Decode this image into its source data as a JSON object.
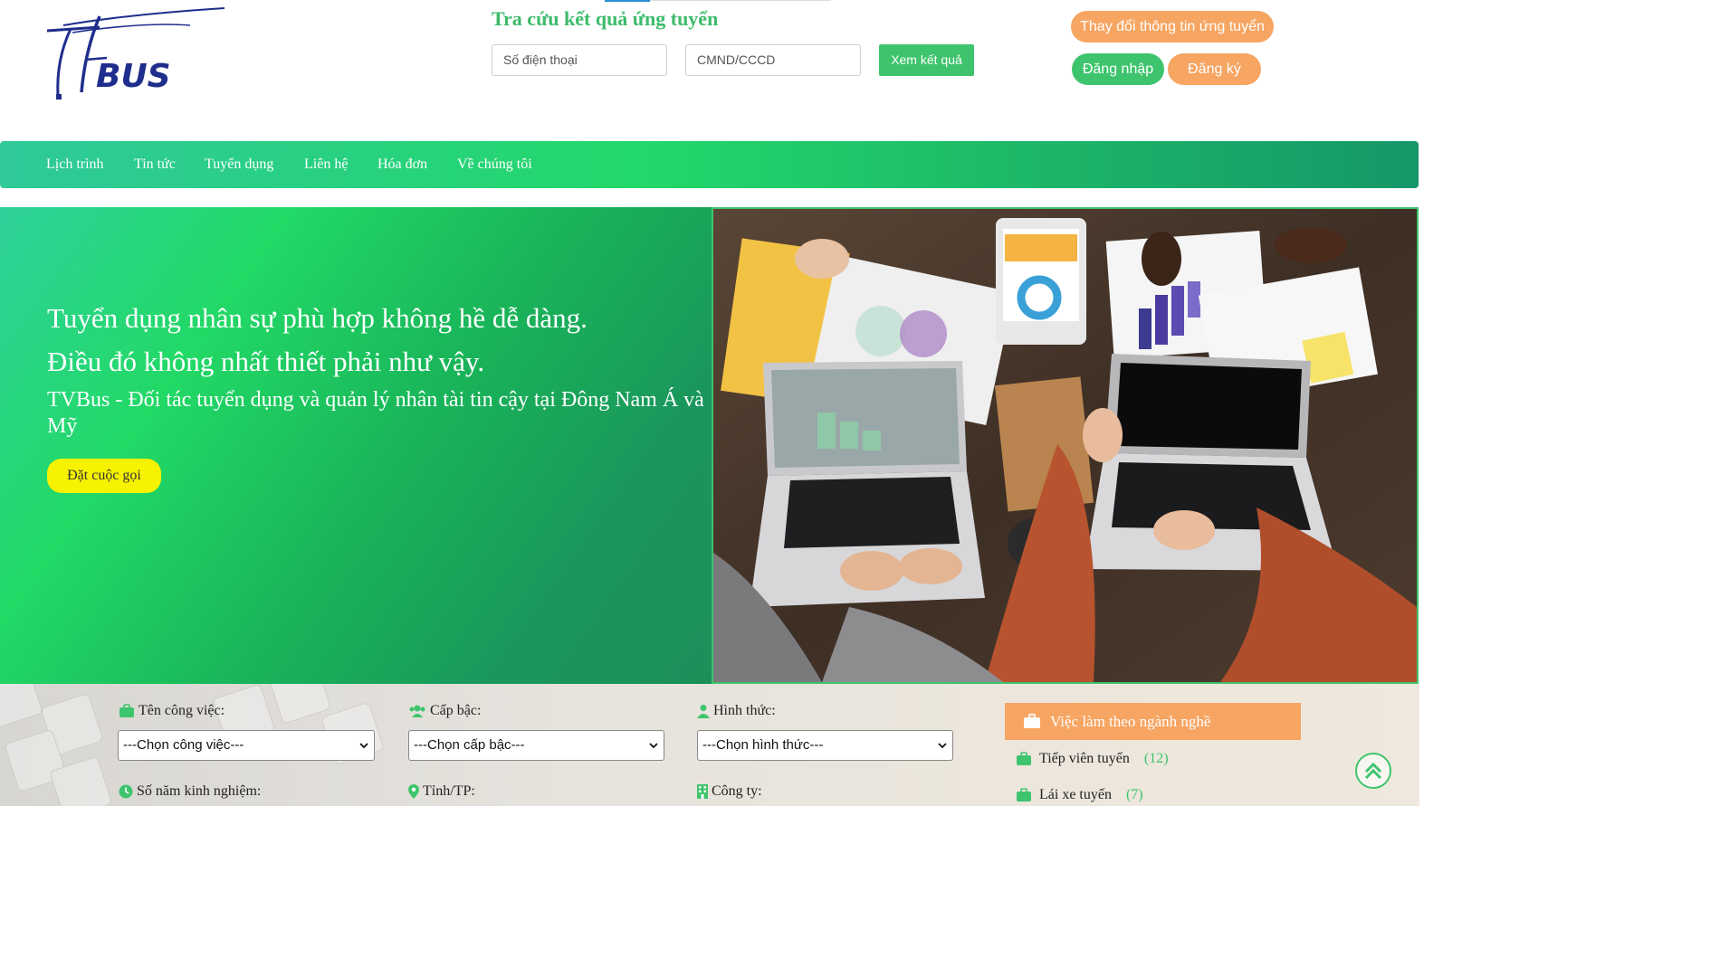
{
  "header": {
    "logo_text": "BUS",
    "lookup_title": "Tra cứu kết quả ứng tuyển",
    "phone_placeholder": "Số điện thoại",
    "id_placeholder": "CMND/CCCD",
    "result_button": "Xem kết quả",
    "change_info_button": "Thay đổi thông tin ứng tuyển",
    "login_button": "Đăng nhập",
    "register_button": "Đăng ký"
  },
  "nav": {
    "items": [
      "Lịch trình",
      "Tin tức",
      "Tuyển dụng",
      "Liên hệ",
      "Hóa đơn",
      "Về chúng tôi"
    ]
  },
  "hero": {
    "headline_1": "Tuyển dụng nhân sự phù hợp không hề dễ dàng.",
    "headline_2": "Điều đó không nhất thiết phải như vậy.",
    "subtitle": "TVBus - Đối tác tuyển dụng và quản lý nhân tài tin cậy tại Đông Nam Á và Mỹ",
    "cta": "Đặt cuộc gọi"
  },
  "filters": {
    "job_label": "Tên công việc:",
    "job_select": "---Chọn công việc---",
    "level_label": "Cấp bậc:",
    "level_select": "---Chọn cấp bậc---",
    "type_label": "Hình thức:",
    "type_select": "---Chọn hình thức---",
    "experience_label": "Số năm kinh nghiệm:",
    "province_label": "Tỉnh/TP:",
    "company_label": "Công ty:"
  },
  "sidebar": {
    "title": "Việc làm theo ngành nghề",
    "items": [
      {
        "label": "Tiếp viên tuyến",
        "count": "(12)"
      },
      {
        "label": "Lái xe tuyến",
        "count": "(7)"
      }
    ]
  },
  "colors": {
    "green": "#3ec46d",
    "orange": "#f7a562",
    "yellow": "#f7f200",
    "logo_blue": "#1f2e8c"
  }
}
